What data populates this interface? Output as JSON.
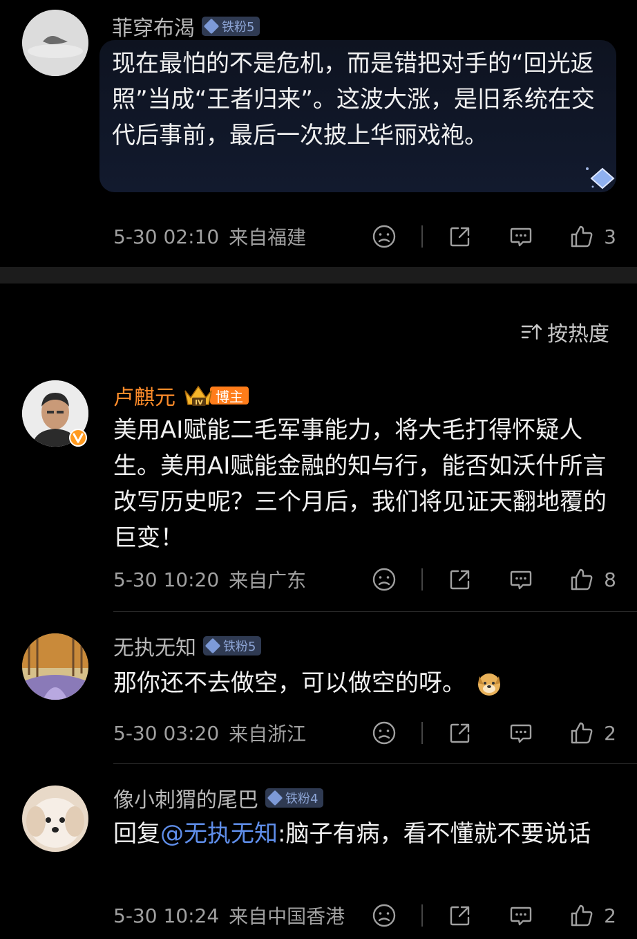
{
  "sort": {
    "label": "按热度"
  },
  "comments": [
    {
      "username": "菲穿布渴",
      "badge": "铁粉5",
      "content": "现在最怕的不是危机，而是错把对手的“回光返照”当成“王者归来”。这波大涨，是旧系统在交代后事前，最后一次披上华丽戏袍。",
      "time": "5-30 02:10",
      "location": "来自福建",
      "likes": "3"
    },
    {
      "username": "卢麒元",
      "badge": "博主",
      "badge_level": "IV",
      "verified": "v",
      "content": "美用AI赋能二毛军事能力，将大毛打得怀疑人生。美用AI赋能金融的知与行，能否如沃什所言改写历史呢？三个月后，我们将见证天翻地覆的巨变！",
      "time": "5-30 10:20",
      "location": "来自广东",
      "likes": "8"
    },
    {
      "username": "无执无知",
      "badge": "铁粉5",
      "content": "那你还不去做空，可以做空的呀。",
      "time": "5-30 03:20",
      "location": "来自浙江",
      "likes": "2"
    },
    {
      "username": "像小刺猬的尾巴",
      "badge": "铁粉4",
      "reply_prefix": "回复",
      "mention": "@无执无知",
      "content": ":脑子有病，看不懂就不要说话",
      "time": "5-30 10:24",
      "location": "来自中国香港",
      "likes": "2"
    }
  ],
  "icons": {
    "dislike": "dislike-face-icon",
    "share": "share-icon",
    "comment": "comment-icon",
    "like": "thumbs-up-icon",
    "sort": "sort-icon"
  },
  "colors": {
    "background": "#000000",
    "vip_name": "#ff8c2a",
    "mention": "#5f8eea",
    "badge_bg": "#2f3a52"
  }
}
